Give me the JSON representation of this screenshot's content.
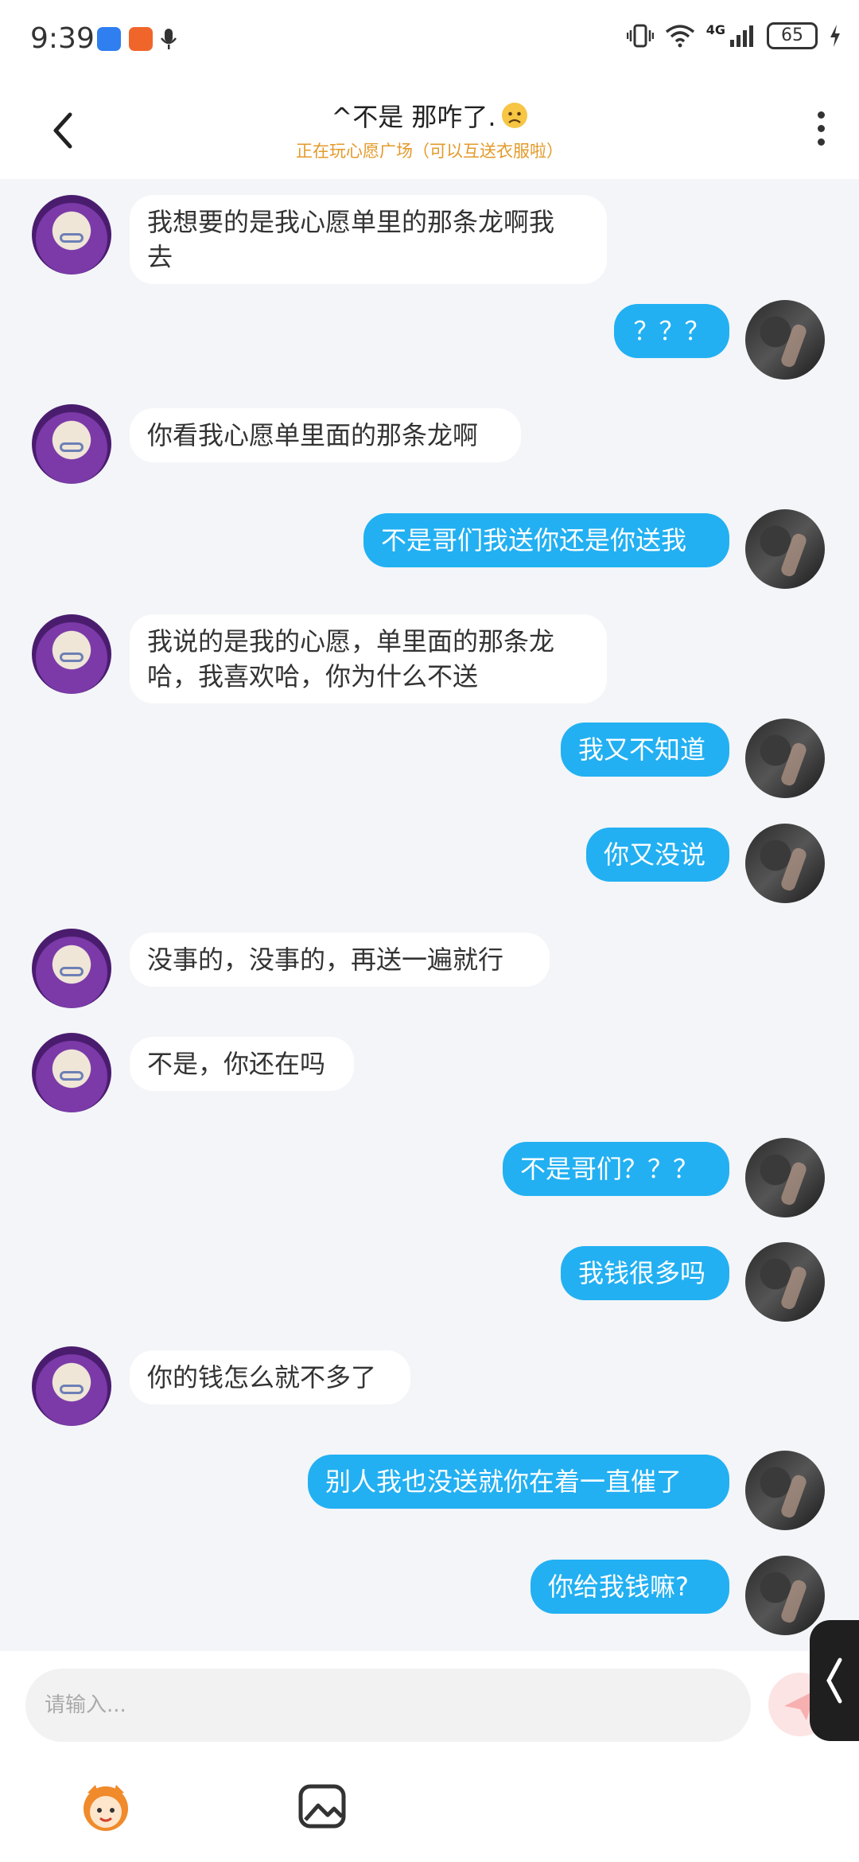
{
  "status": {
    "time": "9:39",
    "battery": "65",
    "network": "4G"
  },
  "header": {
    "title": "^不是  那咋了.",
    "subtitle": "正在玩心愿广场（可以互送衣服啦）"
  },
  "messages": [
    {
      "from": "other",
      "text": "我想要的是我心愿单里的那条龙啊我\n去"
    },
    {
      "from": "me",
      "text": "？？？"
    },
    {
      "from": "other",
      "text": "你看我心愿单里面的那条龙啊"
    },
    {
      "from": "me",
      "text": "不是哥们我送你还是你送我"
    },
    {
      "from": "other",
      "text": "我说的是我的心愿，单里面的那条龙\n哈，我喜欢哈，你为什么不送"
    },
    {
      "from": "me",
      "text": "我又不知道"
    },
    {
      "from": "me",
      "text": "你又没说"
    },
    {
      "from": "other",
      "text": "没事的，没事的，再送一遍就行"
    },
    {
      "from": "other",
      "text": "不是，你还在吗"
    },
    {
      "from": "me",
      "text": "不是哥们？？？"
    },
    {
      "from": "me",
      "text": "我钱很多吗"
    },
    {
      "from": "other",
      "text": "你的钱怎么就不多了"
    },
    {
      "from": "me",
      "text": "别人我也没送就你在着一直催了"
    },
    {
      "from": "me",
      "text": "你给我钱嘛?"
    }
  ],
  "input": {
    "placeholder": "请输入..."
  },
  "colors": {
    "my_bubble": "#22b0f2",
    "other_bubble": "#ffffff",
    "subtitle": "#e39a2a",
    "background": "#f3f5f8"
  },
  "icons": [
    "back-icon",
    "more-icon",
    "send-icon",
    "emoji-mascot-icon",
    "image-icon",
    "side-handle-icon"
  ]
}
